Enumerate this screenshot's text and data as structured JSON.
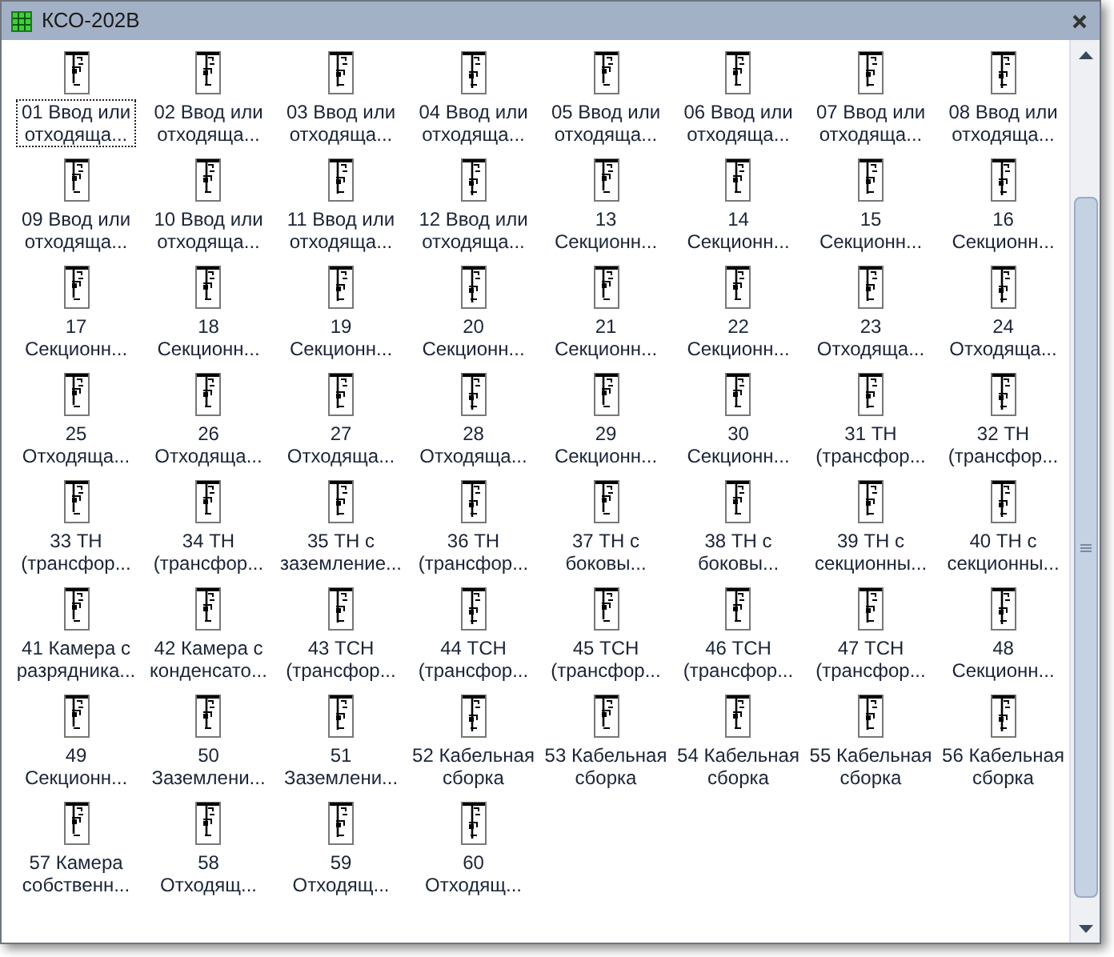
{
  "window": {
    "title": "КСО-202В"
  },
  "items": [
    {
      "lines": [
        "01 Ввод или",
        "отходяща..."
      ],
      "focused": true
    },
    {
      "lines": [
        "02 Ввод или",
        "отходяща..."
      ],
      "focused": false
    },
    {
      "lines": [
        "03 Ввод или",
        "отходяща..."
      ],
      "focused": false
    },
    {
      "lines": [
        "04 Ввод или",
        "отходяща..."
      ],
      "focused": false
    },
    {
      "lines": [
        "05 Ввод или",
        "отходяща..."
      ],
      "focused": false
    },
    {
      "lines": [
        "06 Ввод или",
        "отходяща..."
      ],
      "focused": false
    },
    {
      "lines": [
        "07 Ввод или",
        "отходяща..."
      ],
      "focused": false
    },
    {
      "lines": [
        "08 Ввод или",
        "отходяща..."
      ],
      "focused": false
    },
    {
      "lines": [
        "09 Ввод или",
        "отходяща..."
      ],
      "focused": false
    },
    {
      "lines": [
        "10 Ввод или",
        "отходяща..."
      ],
      "focused": false
    },
    {
      "lines": [
        "11 Ввод или",
        "отходяща..."
      ],
      "focused": false
    },
    {
      "lines": [
        "12 Ввод или",
        "отходяща..."
      ],
      "focused": false
    },
    {
      "lines": [
        "13",
        "Секционн..."
      ],
      "focused": false
    },
    {
      "lines": [
        "14",
        "Секционн..."
      ],
      "focused": false
    },
    {
      "lines": [
        "15",
        "Секционн..."
      ],
      "focused": false
    },
    {
      "lines": [
        "16",
        "Секционн..."
      ],
      "focused": false
    },
    {
      "lines": [
        "17",
        "Секционн..."
      ],
      "focused": false
    },
    {
      "lines": [
        "18",
        "Секционн..."
      ],
      "focused": false
    },
    {
      "lines": [
        "19",
        "Секционн..."
      ],
      "focused": false
    },
    {
      "lines": [
        "20",
        "Секционн..."
      ],
      "focused": false
    },
    {
      "lines": [
        "21",
        "Секционн..."
      ],
      "focused": false
    },
    {
      "lines": [
        "22",
        "Секционн..."
      ],
      "focused": false
    },
    {
      "lines": [
        "23",
        "Отходяща..."
      ],
      "focused": false
    },
    {
      "lines": [
        "24",
        "Отходяща..."
      ],
      "focused": false
    },
    {
      "lines": [
        "25",
        "Отходяща..."
      ],
      "focused": false
    },
    {
      "lines": [
        "26",
        "Отходяща..."
      ],
      "focused": false
    },
    {
      "lines": [
        "27",
        "Отходяща..."
      ],
      "focused": false
    },
    {
      "lines": [
        "28",
        "Отходяща..."
      ],
      "focused": false
    },
    {
      "lines": [
        "29",
        "Секционн..."
      ],
      "focused": false
    },
    {
      "lines": [
        "30",
        "Секционн..."
      ],
      "focused": false
    },
    {
      "lines": [
        "31 ТН",
        "(трансфор..."
      ],
      "focused": false
    },
    {
      "lines": [
        "32 ТН",
        "(трансфор..."
      ],
      "focused": false
    },
    {
      "lines": [
        "33 ТН",
        "(трансфор..."
      ],
      "focused": false
    },
    {
      "lines": [
        "34 ТН",
        "(трансфор..."
      ],
      "focused": false
    },
    {
      "lines": [
        "35 ТН с",
        "заземление..."
      ],
      "focused": false
    },
    {
      "lines": [
        "36 ТН",
        "(трансфор..."
      ],
      "focused": false
    },
    {
      "lines": [
        "37 ТН с",
        "боковы..."
      ],
      "focused": false
    },
    {
      "lines": [
        "38 ТН с",
        "боковы..."
      ],
      "focused": false
    },
    {
      "lines": [
        "39 ТН с",
        "секционны..."
      ],
      "focused": false
    },
    {
      "lines": [
        "40 ТН с",
        "секционны..."
      ],
      "focused": false
    },
    {
      "lines": [
        "41 Камера с",
        "разрядника..."
      ],
      "focused": false
    },
    {
      "lines": [
        "42 Камера с",
        "конденсато..."
      ],
      "focused": false
    },
    {
      "lines": [
        "43 ТСН",
        "(трансфор..."
      ],
      "focused": false
    },
    {
      "lines": [
        "44 ТСН",
        "(трансфор..."
      ],
      "focused": false
    },
    {
      "lines": [
        "45 ТСН",
        "(трансфор..."
      ],
      "focused": false
    },
    {
      "lines": [
        "46 ТСН",
        "(трансфор..."
      ],
      "focused": false
    },
    {
      "lines": [
        "47 ТСН",
        "(трансфор..."
      ],
      "focused": false
    },
    {
      "lines": [
        "48",
        "Секционн..."
      ],
      "focused": false
    },
    {
      "lines": [
        "49",
        "Секционн..."
      ],
      "focused": false
    },
    {
      "lines": [
        "50",
        "Заземлени..."
      ],
      "focused": false
    },
    {
      "lines": [
        "51",
        "Заземлени..."
      ],
      "focused": false
    },
    {
      "lines": [
        "52 Кабельная",
        "сборка"
      ],
      "focused": false
    },
    {
      "lines": [
        "53 Кабельная",
        "сборка"
      ],
      "focused": false
    },
    {
      "lines": [
        "54 Кабельная",
        "сборка"
      ],
      "focused": false
    },
    {
      "lines": [
        "55 Кабельная",
        "сборка"
      ],
      "focused": false
    },
    {
      "lines": [
        "56 Кабельная",
        "сборка"
      ],
      "focused": false
    },
    {
      "lines": [
        "57 Камера",
        "собственн..."
      ],
      "focused": false
    },
    {
      "lines": [
        "58",
        "Отходящ..."
      ],
      "focused": false
    },
    {
      "lines": [
        "59",
        "Отходящ..."
      ],
      "focused": false
    },
    {
      "lines": [
        "60",
        "Отходящ..."
      ],
      "focused": false
    }
  ]
}
